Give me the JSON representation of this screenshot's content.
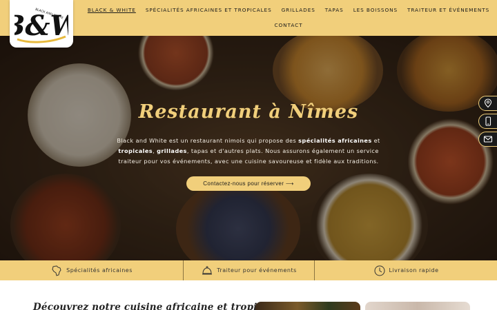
{
  "logo": {
    "text": "B&W",
    "tagline": "BLACK AND WHITE"
  },
  "nav": {
    "items": [
      {
        "label": "BLACK & WHITE",
        "active": true
      },
      {
        "label": "SPÉCIALITÉS AFRICAINES ET TROPICALES"
      },
      {
        "label": "GRILLADES"
      },
      {
        "label": "TAPAS"
      },
      {
        "label": "LES BOISSONS"
      },
      {
        "label": "TRAITEUR ET ÉVÉNEMENTS"
      },
      {
        "label": "CONTACT"
      }
    ]
  },
  "hero": {
    "title": "Restaurant à Nîmes",
    "text_1": "Black and White est un restaurant nimois qui propose des ",
    "bold_1": "spécialités africaines",
    "text_2": " et ",
    "bold_2": "tropicales",
    "text_3": ", ",
    "bold_3": "grillades",
    "text_4": ", tapas et d'autres plats. Nous assurons également un service traiteur pour vos événements, avec une cuisine savoureuse et fidèle aux traditions.",
    "cta_label": "Contactez-nous pour réserver ⟶"
  },
  "side_contacts": [
    {
      "icon": "map-pin-icon"
    },
    {
      "icon": "phone-icon"
    },
    {
      "icon": "mail-icon"
    }
  ],
  "features": [
    {
      "icon": "africa-map-icon",
      "label": "Spécialités africaines"
    },
    {
      "icon": "cloche-icon",
      "label": "Traiteur pour événements"
    },
    {
      "icon": "clock-icon",
      "label": "Livraison rapide"
    }
  ],
  "section": {
    "title": "Découvrez notre cuisine africaine et tropicale"
  },
  "colors": {
    "accent": "#f1cf7b",
    "dark": "#1a1a1a"
  }
}
